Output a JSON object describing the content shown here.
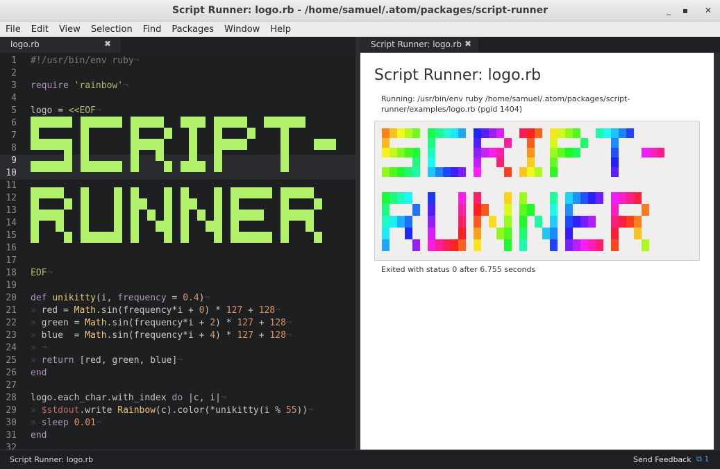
{
  "window": {
    "title": "Script Runner: logo.rb - /home/samuel/.atom/packages/script-runner"
  },
  "menu": [
    "File",
    "Edit",
    "View",
    "Selection",
    "Find",
    "Packages",
    "Window",
    "Help"
  ],
  "tabs": {
    "editor": "logo.rb",
    "preview": "Script Runner: logo.rb"
  },
  "editor": {
    "current_lines": [
      9,
      10
    ],
    "lines": [
      {
        "n": "1",
        "tokens": [
          {
            "t": "#!/usr/bin/env ruby",
            "c": "c-com"
          },
          {
            "t": "¬",
            "c": "c-ws"
          }
        ]
      },
      {
        "n": "2",
        "tokens": []
      },
      {
        "n": "3",
        "tokens": [
          {
            "t": "require ",
            "c": "c-kw"
          },
          {
            "t": "'rainbow'",
            "c": "c-str"
          },
          {
            "t": "¬",
            "c": "c-ws"
          }
        ]
      },
      {
        "n": "4",
        "tokens": []
      },
      {
        "n": "5",
        "tokens": [
          {
            "t": "logo = ",
            "c": ""
          },
          {
            "t": "<<EOF",
            "c": "c-str"
          },
          {
            "t": "¬",
            "c": "c-ws"
          }
        ]
      },
      {
        "n": "6",
        "tokens": []
      },
      {
        "n": "7",
        "tokens": []
      },
      {
        "n": "8",
        "tokens": []
      },
      {
        "n": "9",
        "tokens": []
      },
      {
        "n": "10",
        "tokens": []
      },
      {
        "n": "11",
        "tokens": []
      },
      {
        "n": "12",
        "tokens": []
      },
      {
        "n": "13",
        "tokens": []
      },
      {
        "n": "14",
        "tokens": []
      },
      {
        "n": "15",
        "tokens": []
      },
      {
        "n": "16",
        "tokens": []
      },
      {
        "n": "17",
        "tokens": []
      },
      {
        "n": "18",
        "tokens": [
          {
            "t": "EOF",
            "c": "c-str"
          },
          {
            "t": "¬",
            "c": "c-ws"
          }
        ]
      },
      {
        "n": "19",
        "tokens": []
      },
      {
        "n": "20",
        "tokens": [
          {
            "t": "def ",
            "c": "c-kw"
          },
          {
            "t": "unikitty",
            "c": "c-cls"
          },
          {
            "t": "(i, ",
            "c": ""
          },
          {
            "t": "frequency",
            "c": "c-kw"
          },
          {
            "t": " = ",
            "c": ""
          },
          {
            "t": "0.4",
            "c": "c-num"
          },
          {
            "t": ")",
            "c": ""
          },
          {
            "t": "¬",
            "c": "c-ws"
          }
        ]
      },
      {
        "n": "21",
        "tokens": [
          {
            "t": "» ",
            "c": "c-ws"
          },
          {
            "t": "red = ",
            "c": ""
          },
          {
            "t": "Math",
            "c": "c-cls"
          },
          {
            "t": ".sin(frequency*i + ",
            "c": ""
          },
          {
            "t": "0",
            "c": "c-num"
          },
          {
            "t": ") * ",
            "c": ""
          },
          {
            "t": "127",
            "c": "c-num"
          },
          {
            "t": " + ",
            "c": ""
          },
          {
            "t": "128",
            "c": "c-num"
          },
          {
            "t": "¬",
            "c": "c-ws"
          }
        ]
      },
      {
        "n": "22",
        "tokens": [
          {
            "t": "» ",
            "c": "c-ws"
          },
          {
            "t": "green = ",
            "c": ""
          },
          {
            "t": "Math",
            "c": "c-cls"
          },
          {
            "t": ".sin(frequency*i + ",
            "c": ""
          },
          {
            "t": "2",
            "c": "c-num"
          },
          {
            "t": ") * ",
            "c": ""
          },
          {
            "t": "127",
            "c": "c-num"
          },
          {
            "t": " + ",
            "c": ""
          },
          {
            "t": "128",
            "c": "c-num"
          },
          {
            "t": "¬",
            "c": "c-ws"
          }
        ]
      },
      {
        "n": "23",
        "tokens": [
          {
            "t": "» ",
            "c": "c-ws"
          },
          {
            "t": "blue  = ",
            "c": ""
          },
          {
            "t": "Math",
            "c": "c-cls"
          },
          {
            "t": ".sin(frequency*i + ",
            "c": ""
          },
          {
            "t": "4",
            "c": "c-num"
          },
          {
            "t": ") * ",
            "c": ""
          },
          {
            "t": "127",
            "c": "c-num"
          },
          {
            "t": " + ",
            "c": ""
          },
          {
            "t": "128",
            "c": "c-num"
          },
          {
            "t": "¬",
            "c": "c-ws"
          }
        ]
      },
      {
        "n": "24",
        "tokens": [
          {
            "t": "» ¬",
            "c": "c-ws"
          }
        ]
      },
      {
        "n": "25",
        "tokens": [
          {
            "t": "» ",
            "c": "c-ws"
          },
          {
            "t": "return ",
            "c": "c-kw"
          },
          {
            "t": "[red, green, blue]",
            "c": ""
          },
          {
            "t": "¬",
            "c": "c-ws"
          }
        ]
      },
      {
        "n": "26",
        "tokens": [
          {
            "t": "end",
            "c": "c-kw"
          }
        ]
      },
      {
        "n": "27",
        "tokens": []
      },
      {
        "n": "28",
        "tokens": [
          {
            "t": "logo.each_char.with_index ",
            "c": ""
          },
          {
            "t": "do",
            "c": "c-kw"
          },
          {
            "t": " |c, i|",
            "c": ""
          },
          {
            "t": "¬",
            "c": "c-ws"
          }
        ]
      },
      {
        "n": "29",
        "tokens": [
          {
            "t": "» ",
            "c": "c-ws"
          },
          {
            "t": "$stdout",
            "c": "c-var"
          },
          {
            "t": ".write ",
            "c": ""
          },
          {
            "t": "Rainbow",
            "c": "c-cls"
          },
          {
            "t": "(c).color(*unikitty(i % ",
            "c": ""
          },
          {
            "t": "55",
            "c": "c-num"
          },
          {
            "t": "))",
            "c": ""
          },
          {
            "t": "¬",
            "c": "c-ws"
          }
        ]
      },
      {
        "n": "30",
        "tokens": [
          {
            "t": "» ",
            "c": "c-ws"
          },
          {
            "t": "sleep ",
            "c": "c-kw"
          },
          {
            "t": "0.01",
            "c": "c-num"
          },
          {
            "t": "¬",
            "c": "c-ws"
          }
        ]
      },
      {
        "n": "31",
        "tokens": [
          {
            "t": "end",
            "c": "c-kw"
          }
        ]
      },
      {
        "n": "32",
        "tokens": []
      }
    ],
    "art_color": "#b0f06a"
  },
  "preview": {
    "title": "Script Runner: logo.rb",
    "running": "Running: /usr/bin/env ruby /home/samuel/.atom/packages/script-runner/examples/logo.rb (pgid 1404)",
    "exit": "Exited with status 0 after 6.755 seconds"
  },
  "status": {
    "left": "Script Runner: logo.rb",
    "feedback": "Send Feedback",
    "count": "1"
  }
}
